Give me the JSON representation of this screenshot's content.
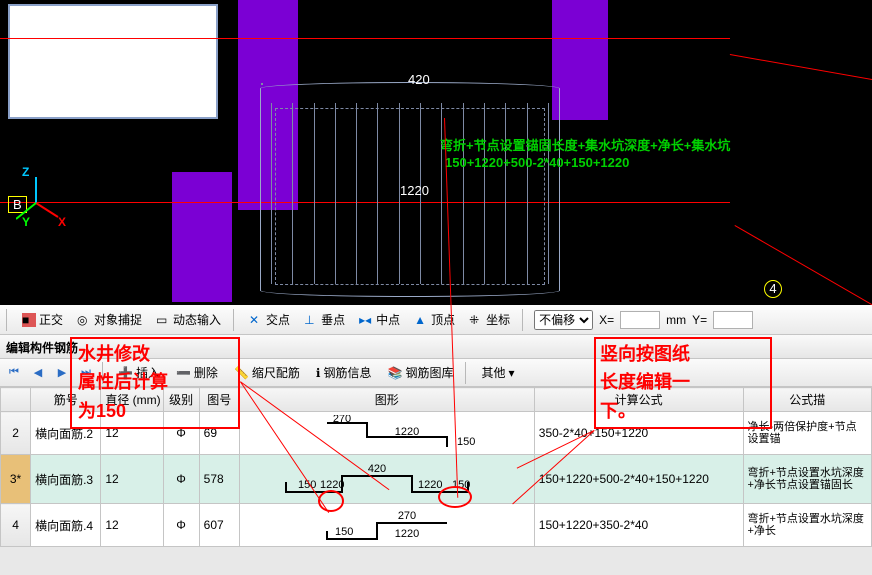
{
  "viewport": {
    "dim_top": "420",
    "dim_bottom": "1220",
    "formula_line1": "弯折+节点设置锚固长度+集水坑深度+净长+集水坑",
    "formula_line2": "150+1220+500-2*40+150+1220",
    "axis_b": "B",
    "axis_4": "4",
    "gizmo_x": "X",
    "gizmo_y": "Y",
    "gizmo_z": "Z"
  },
  "toolbar": {
    "ortho": "正交",
    "osnap": "对象捕捉",
    "dyn": "动态输入",
    "xpoint": "交点",
    "perp": "垂点",
    "mid": "中点",
    "top": "顶点",
    "coord": "坐标",
    "offset_sel": "不偏移",
    "x_label": "X=",
    "y_label": "Y=",
    "mm": "mm"
  },
  "panel": {
    "title": "编辑构件钢筋",
    "nav_tip": "◀ ▶",
    "insert": "插入",
    "delete": "删除",
    "scale": "缩尺配筋",
    "info": "钢筋信息",
    "lib": "钢筋图库",
    "other": "其他"
  },
  "grid": {
    "headers": {
      "name": "筋号",
      "dia": "直径 (mm)",
      "lvl": "级别",
      "no": "图号",
      "shape": "图形",
      "formula": "计算公式",
      "desc": "公式描"
    },
    "rows": [
      {
        "idx": "2",
        "name": "横向面筋.2",
        "dia": "12",
        "lvl": "Φ",
        "no": "69",
        "shape": {
          "a": "270",
          "b": "1220",
          "c": "150"
        },
        "formula": "350-2*40+150+1220",
        "desc": "净长-两倍保护度+节点设置锚"
      },
      {
        "idx": "3*",
        "name": "横向面筋.3",
        "dia": "12",
        "lvl": "Φ",
        "no": "578",
        "shape": {
          "a": "150",
          "b": "1220",
          "c": "420",
          "d": "1220",
          "e": "150"
        },
        "formula": "150+1220+500-2*40+150+1220",
        "desc": "弯折+节点设置水坑深度+净长节点设置锚固长"
      },
      {
        "idx": "4",
        "name": "横向面筋.4",
        "dia": "12",
        "lvl": "Φ",
        "no": "607",
        "shape": {
          "a": "150",
          "b": "270",
          "c": "1220"
        },
        "formula": "150+1220+350-2*40",
        "desc": "弯折+节点设置水坑深度+净长"
      }
    ]
  },
  "annotations": {
    "left_title1": "水井修改",
    "left_title2": "属性后计算",
    "left_title3": "为150",
    "right_title1": "竖向按图纸",
    "right_title2": "长度编辑一",
    "right_title3": "下。"
  }
}
